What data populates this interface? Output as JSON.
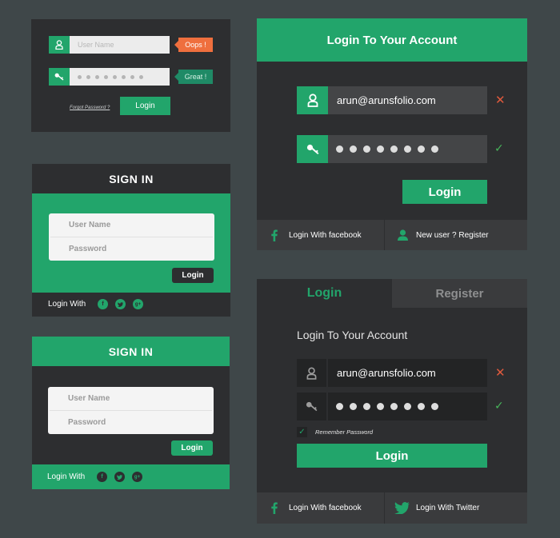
{
  "panel1": {
    "username_placeholder": "User Name",
    "error_tip": "Oops !",
    "success_tip": "Great !",
    "forgot_link": "Forgot Password ?",
    "login_button": "Login"
  },
  "panel2": {
    "heading": "SIGN IN",
    "username_placeholder": "User Name",
    "password_placeholder": "Password",
    "login_button": "Login",
    "login_with_label": "Login With",
    "social_icons": [
      "facebook-icon",
      "twitter-icon",
      "google-plus-icon"
    ]
  },
  "panel3": {
    "heading": "SIGN IN",
    "username_placeholder": "User Name",
    "password_placeholder": "Password",
    "login_button": "Login",
    "login_with_label": "Login With",
    "social_icons": [
      "facebook-icon",
      "twitter-icon",
      "google-plus-icon"
    ]
  },
  "panel4": {
    "heading": "Login To Your Account",
    "email_value": "arun@arunsfolio.com",
    "login_button": "Login",
    "facebook_label": "Login With facebook",
    "register_label": "New user ? Register"
  },
  "panel5": {
    "tab_login": "Login",
    "tab_register": "Register",
    "heading": "Login To Your Account",
    "email_value": "arun@arunsfolio.com",
    "remember_label": "Remember Password",
    "login_button": "Login",
    "facebook_label": "Login With facebook",
    "twitter_label": "Login With Twitter"
  },
  "colors": {
    "background": "#3f4749",
    "panel_dark": "#2d2e30",
    "accent_green": "#22a56b",
    "error_orange": "#ef6f3e",
    "error_x": "#e05a3d",
    "ok_check": "#47b45a"
  },
  "password_mask_count": 8
}
